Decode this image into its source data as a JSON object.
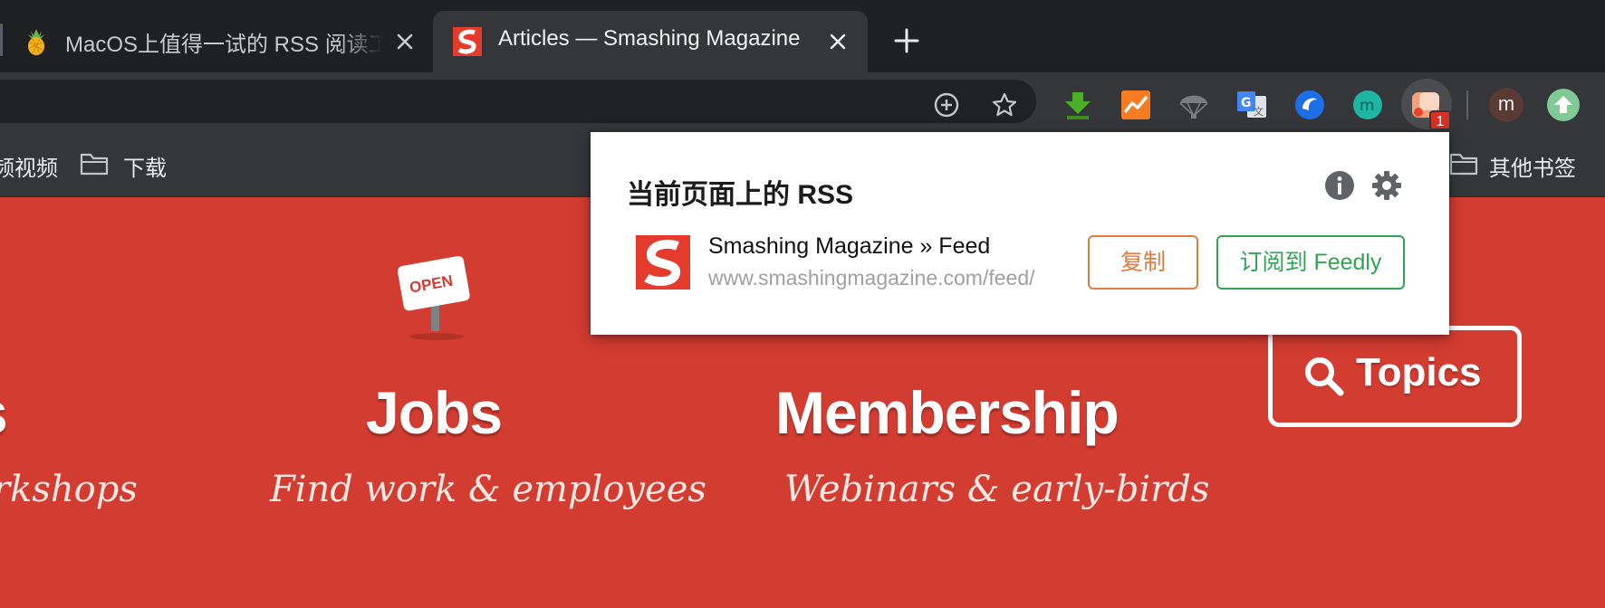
{
  "browser": {
    "tabs": [
      {
        "title": "MacOS上值得一试的 RSS 阅读工具",
        "active": false,
        "favicon": "pineapple-icon"
      },
      {
        "title": "Articles — Smashing Magazine",
        "active": true,
        "favicon": "smashing-s-icon"
      }
    ],
    "new_tab_icon": "plus-icon",
    "close_icon": "close-icon"
  },
  "toolbar": {
    "omnibox_icons": [
      "add-circle-icon",
      "star-icon"
    ],
    "extensions": [
      "download-arrow-icon",
      "chart-line-icon",
      "parachute-icon",
      "google-translate-icon",
      "blue-circle-icon",
      "m-circle-icon",
      "rss-extension-icon"
    ],
    "badge_count": "1",
    "avatar_letter": "m",
    "update_icon": "arrow-up-icon"
  },
  "bookmarks": {
    "left_partial": "频视频",
    "folder_download": "下载",
    "other": "其他书签"
  },
  "page": {
    "left_partial_title": "s",
    "left_partial_sub": "rkshops",
    "jobs_title": "Jobs",
    "jobs_sub": "Find work & employees",
    "jobs_sign": "OPEN",
    "membership_title": "Membership",
    "membership_sub": "Webinars & early-birds",
    "topics_label": "Topics"
  },
  "popup": {
    "heading": "当前页面上的 RSS",
    "feed_title": "Smashing Magazine » Feed",
    "feed_url": "www.smashingmagazine.com/feed/",
    "copy_label": "复制",
    "subscribe_label": "订阅到 Feedly"
  },
  "colors": {
    "page_red": "#d33c31",
    "tab_active": "#35363a",
    "tabstrip": "#1f2023",
    "copy_orange": "#e57a3e",
    "feedly_green": "#2fa552",
    "badge_red": "#d93025"
  }
}
